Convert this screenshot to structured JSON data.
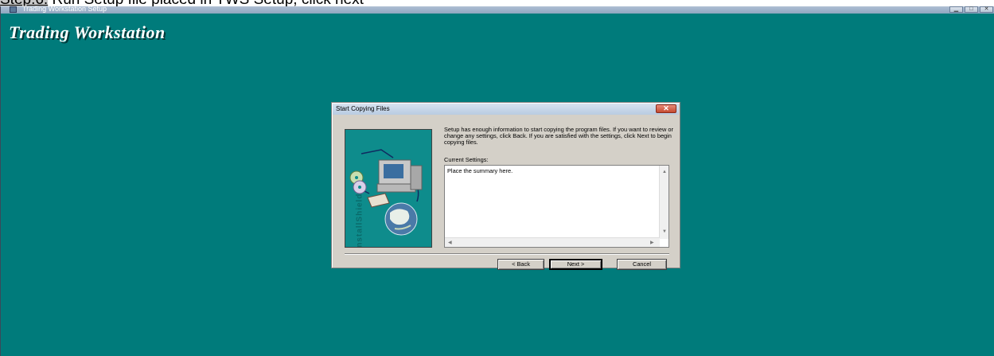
{
  "caption": {
    "step": "Step.6.",
    "text": " Run Setup file placed in TWS Setup, click next"
  },
  "window": {
    "title": "Trading Workstation Setup",
    "brand": "Trading Workstation",
    "controls": [
      "minimize-icon",
      "maximize-icon",
      "close-icon"
    ]
  },
  "dialog": {
    "title": "Start Copying Files",
    "close_glyph": "✕",
    "message": "Setup has enough information to start copying the program files. If you want to review or change any settings, click Back.  If you are satisfied with the settings, click Next to begin copying files.",
    "current_settings_label": "Current Settings:",
    "summary_text": "Place the summary here.",
    "art_vertical_text": "InstallShield",
    "buttons": {
      "back": "< Back",
      "next": "Next >",
      "cancel": "Cancel"
    }
  },
  "colors": {
    "desktop": "#007b7b",
    "dialog_face": "#d4d0c8",
    "close_red": "#c44a30"
  }
}
